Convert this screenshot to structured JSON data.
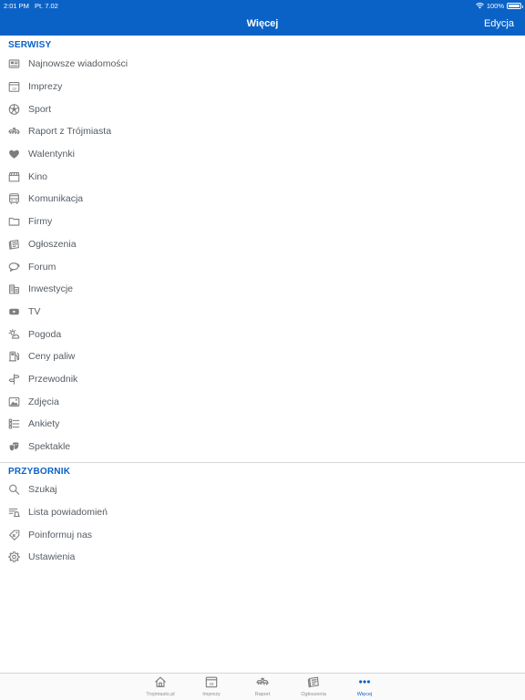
{
  "status_bar": {
    "time": "2:01 PM",
    "date": "Pt. 7.02",
    "battery": "100%",
    "battery_level": 1.0
  },
  "nav": {
    "title": "Więcej",
    "edit_label": "Edycja"
  },
  "colors": {
    "accent": "#0a62c6",
    "text": "#555c63",
    "icon": "#7d7d7d",
    "tab_inactive": "#8e8e93"
  },
  "serwisy": {
    "header": "SERWISY",
    "items": [
      {
        "label": "Najnowsze wiadomości",
        "icon": "newspaper-icon"
      },
      {
        "label": "Imprezy",
        "icon": "calendar-icon"
      },
      {
        "label": "Sport",
        "icon": "soccer-ball-icon"
      },
      {
        "label": "Raport z Trójmiasta",
        "icon": "car-crash-icon"
      },
      {
        "label": "Walentynki",
        "icon": "heart-icon"
      },
      {
        "label": "Kino",
        "icon": "clapperboard-icon"
      },
      {
        "label": "Komunikacja",
        "icon": "bus-icon"
      },
      {
        "label": "Firmy",
        "icon": "folder-icon"
      },
      {
        "label": "Ogłoszenia",
        "icon": "classifieds-icon"
      },
      {
        "label": "Forum",
        "icon": "chat-bubbles-icon"
      },
      {
        "label": "Inwestycje",
        "icon": "buildings-icon"
      },
      {
        "label": "TV",
        "icon": "tv-icon"
      },
      {
        "label": "Pogoda",
        "icon": "weather-icon"
      },
      {
        "label": "Ceny paliw",
        "icon": "fuel-pump-icon"
      },
      {
        "label": "Przewodnik",
        "icon": "signpost-icon"
      },
      {
        "label": "Zdjęcia",
        "icon": "photo-icon"
      },
      {
        "label": "Ankiety",
        "icon": "poll-icon"
      },
      {
        "label": "Spektakle",
        "icon": "theater-masks-icon"
      }
    ]
  },
  "przybornik": {
    "header": "PRZYBORNIK",
    "items": [
      {
        "label": "Szukaj",
        "icon": "search-icon"
      },
      {
        "label": "Lista powiadomień",
        "icon": "notification-list-icon"
      },
      {
        "label": "Poinformuj nas",
        "icon": "report-tag-icon"
      },
      {
        "label": "Ustawienia",
        "icon": "gear-icon"
      }
    ]
  },
  "tabbar": {
    "tabs": [
      {
        "label": "Trojmiasto.pl",
        "icon": "home-icon",
        "active": false
      },
      {
        "label": "Imprezy",
        "icon": "calendar-icon",
        "active": false
      },
      {
        "label": "Raport",
        "icon": "car-crash-icon",
        "active": false
      },
      {
        "label": "Ogłoszenia",
        "icon": "classifieds-icon",
        "active": false
      },
      {
        "label": "Więcej",
        "icon": "more-dots-icon",
        "active": true
      }
    ]
  }
}
